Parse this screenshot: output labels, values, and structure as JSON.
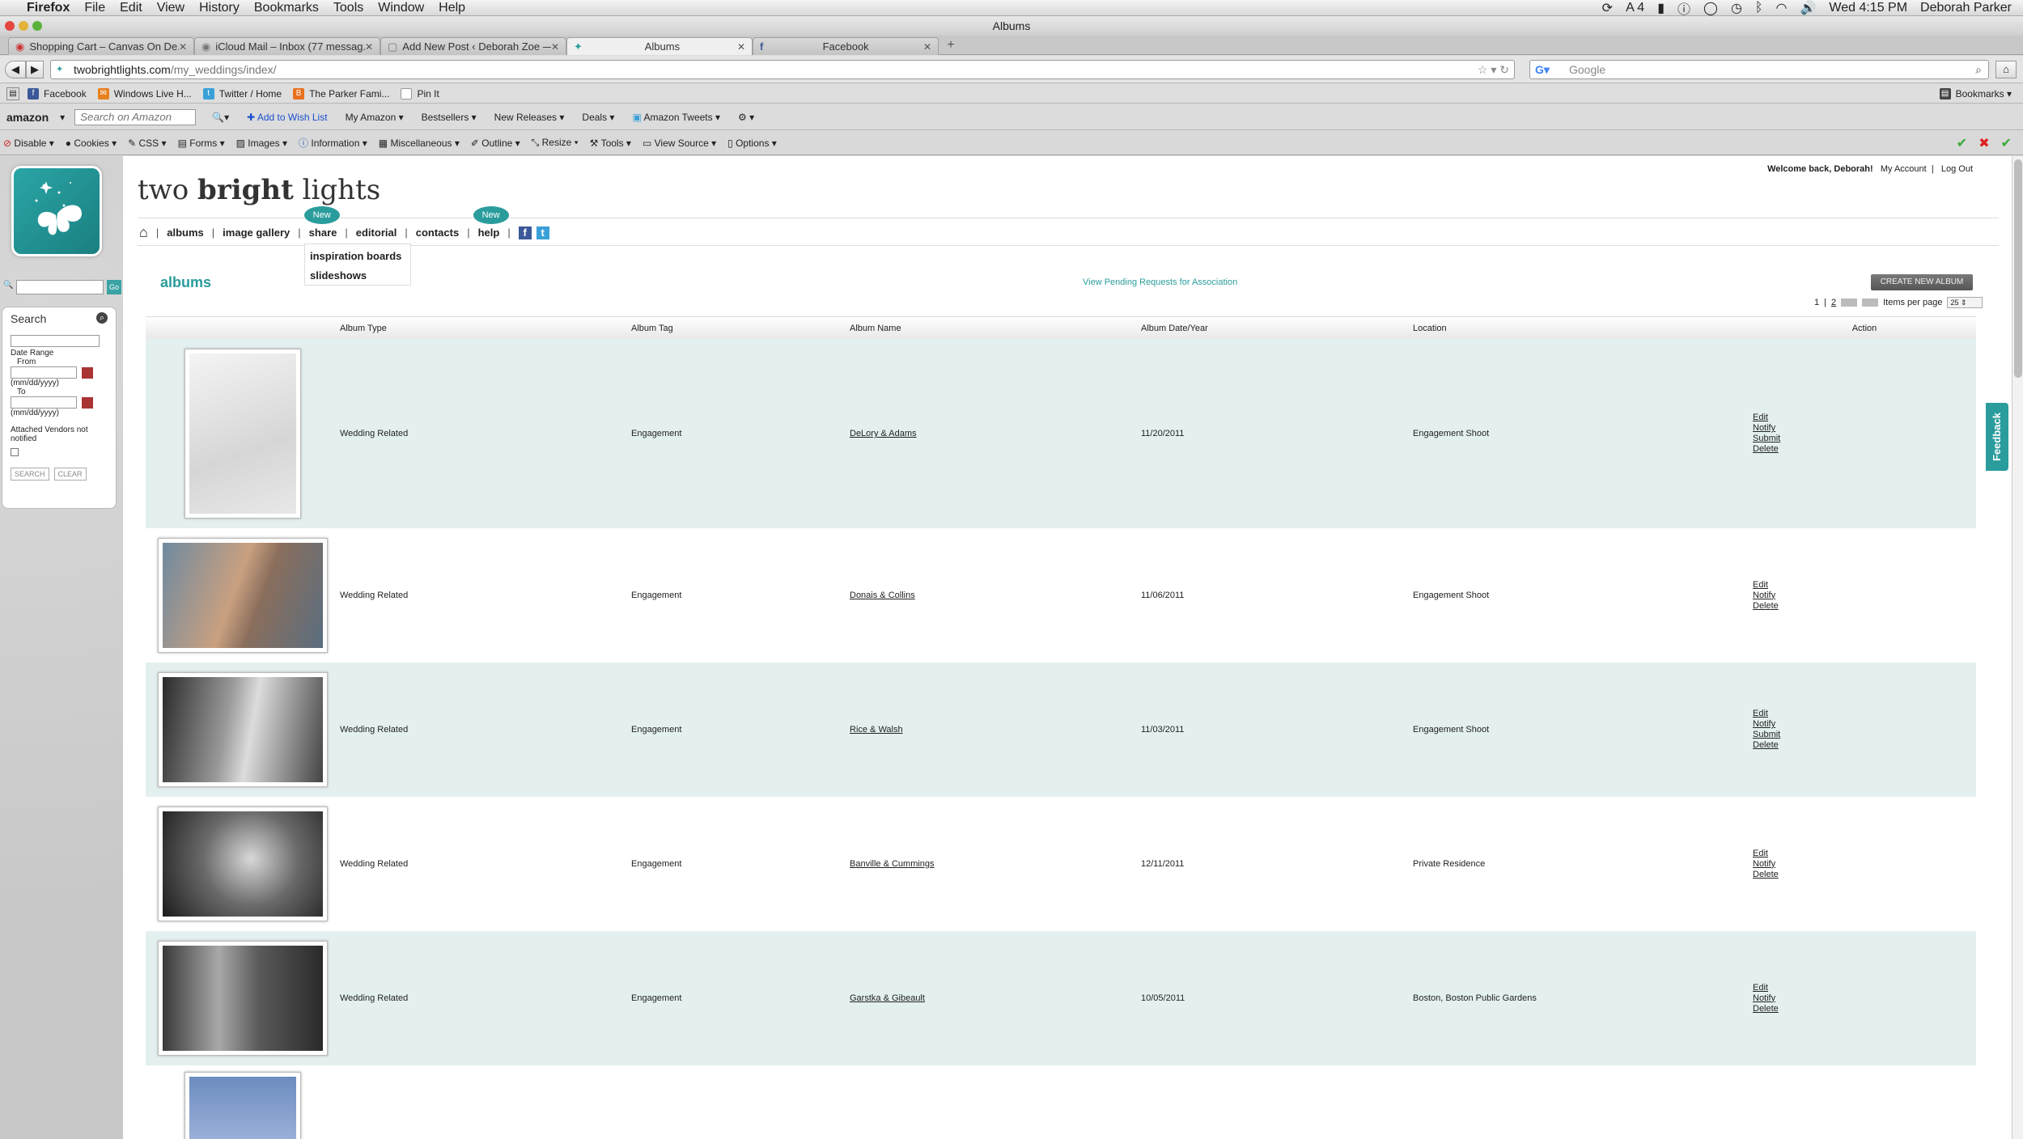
{
  "menubar": {
    "app": "Firefox",
    "items": [
      "File",
      "Edit",
      "View",
      "History",
      "Bookmarks",
      "Tools",
      "Window",
      "Help"
    ],
    "status_num": "4",
    "clock": "Wed 4:15 PM",
    "user": "Deborah Parker"
  },
  "window": {
    "title": "Albums"
  },
  "tabs": [
    {
      "label": "Shopping Cart – Canvas On De..."
    },
    {
      "label": "iCloud Mail – Inbox (77 messag..."
    },
    {
      "label": "Add New Post ‹ Deborah Zoe — ..."
    },
    {
      "label": "Albums"
    },
    {
      "label": "Facebook"
    }
  ],
  "address": {
    "domain": "twobrightlights.com",
    "path": "/my_weddings/index/",
    "search_placeholder": "Google"
  },
  "bookmarks": {
    "items": [
      "Facebook",
      "Windows Live H...",
      "Twitter / Home",
      "The Parker Fami...",
      "Pin It"
    ],
    "right": "Bookmarks"
  },
  "amazon_bar": {
    "logo": "amazon",
    "search_placeholder": "Search on Amazon",
    "wishlist": "Add to Wish List",
    "items": [
      "My Amazon",
      "Bestsellers",
      "New Releases",
      "Deals",
      "Amazon Tweets"
    ]
  },
  "webdev_bar": {
    "items": [
      "Disable",
      "Cookies",
      "CSS",
      "Forms",
      "Images",
      "Information",
      "Miscellaneous",
      "Outline",
      "Resize",
      "Tools",
      "View Source",
      "Options"
    ]
  },
  "sidebar": {
    "go_label": "Go",
    "search_title": "Search",
    "date_range": "Date Range",
    "from": "From",
    "to": "To",
    "date_hint": "(mm/dd/yyyy)",
    "attached_vendors": "Attached Vendors not notified",
    "search_btn": "SEARCH",
    "clear_btn": "CLEAR"
  },
  "site": {
    "brand_pre": "two ",
    "brand_bold": "bright",
    "brand_post": " lights",
    "welcome": "Welcome back, Deborah!",
    "my_account": "My Account",
    "logout": "Log Out",
    "nav": {
      "albums": "albums",
      "image_gallery": "image gallery",
      "share": "share",
      "editorial": "editorial",
      "contacts": "contacts",
      "help": "help",
      "new_badge": "New"
    },
    "dropdown": [
      "inspiration boards",
      "slideshows"
    ],
    "feedback": "Feedback"
  },
  "albums": {
    "title": "albums",
    "pending_link": "View Pending Requests for Association",
    "create_btn": "CREATE NEW ALBUM",
    "pager": {
      "page1": "1",
      "page2": "2",
      "items_label": "Items per page",
      "items_value": "25"
    },
    "columns": [
      "Album Type",
      "Album Tag",
      "Album Name",
      "Album Date/Year",
      "Location",
      "Action"
    ],
    "rows": [
      {
        "type": "Wedding Related",
        "tag": "Engagement",
        "name": "DeLory & Adams",
        "date": "11/20/2011",
        "location": "Engagement Shoot",
        "actions": [
          "Edit",
          "Notify",
          "Submit",
          "Delete"
        ]
      },
      {
        "type": "Wedding Related",
        "tag": "Engagement",
        "name": "Donais & Collins",
        "date": "11/06/2011",
        "location": "Engagement Shoot",
        "actions": [
          "Edit",
          "Notify",
          "Delete"
        ]
      },
      {
        "type": "Wedding Related",
        "tag": "Engagement",
        "name": "Rice & Walsh",
        "date": "11/03/2011",
        "location": "Engagement Shoot",
        "actions": [
          "Edit",
          "Notify",
          "Submit",
          "Delete"
        ]
      },
      {
        "type": "Wedding Related",
        "tag": "Engagement",
        "name": "Banville & Cummings",
        "date": "12/11/2011",
        "location": "Private Residence",
        "actions": [
          "Edit",
          "Notify",
          "Delete"
        ]
      },
      {
        "type": "Wedding Related",
        "tag": "Engagement",
        "name": "Garstka & Gibeault",
        "date": "10/05/2011",
        "location": "Boston, Boston Public Gardens",
        "actions": [
          "Edit",
          "Notify",
          "Delete"
        ]
      }
    ]
  },
  "colors": {
    "accent": "#2a9c9c",
    "row_alt": "#e4f0f0"
  }
}
